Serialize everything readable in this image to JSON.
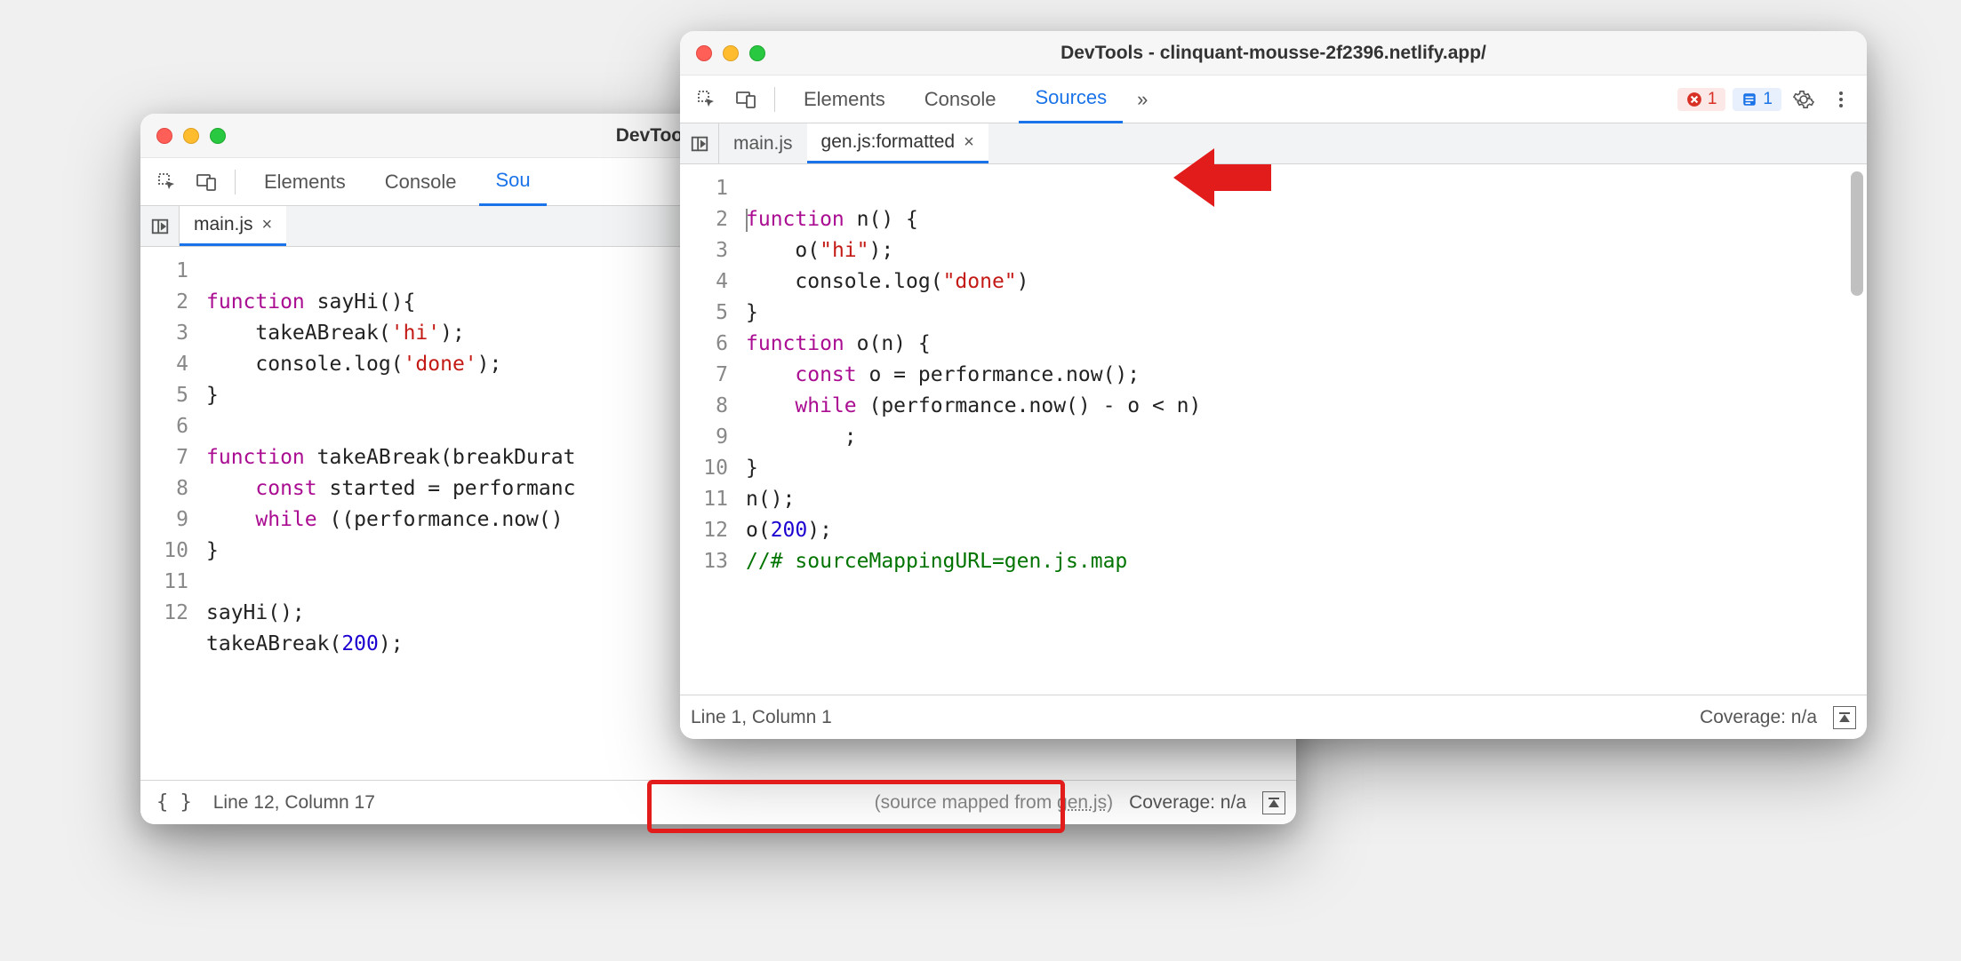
{
  "windows": {
    "back": {
      "title": "DevTools - clinquant-m",
      "tabs": {
        "elements": "Elements",
        "console": "Console",
        "sources": "Sou"
      },
      "file_tabs": [
        {
          "label": "main.js",
          "active": true
        }
      ],
      "code": {
        "lines": [
          "function sayHi(){",
          "    takeABreak('hi');",
          "    console.log('done');",
          "}",
          "",
          "function takeABreak(breakDurat",
          "    const started = performanc",
          "    while ((performance.now() ",
          "}",
          "",
          "sayHi();",
          "takeABreak(200);"
        ]
      },
      "status": {
        "cursor": "Line 12, Column 17",
        "source_mapped": "(source mapped from ",
        "source_mapped_link": "gen.js",
        "source_mapped_end": ")",
        "coverage": "Coverage: n/a"
      }
    },
    "front": {
      "title": "DevTools - clinquant-mousse-2f2396.netlify.app/",
      "tabs": {
        "elements": "Elements",
        "console": "Console",
        "sources": "Sources",
        "more": "»"
      },
      "badges": {
        "errors": "1",
        "info": "1"
      },
      "file_tabs": [
        {
          "label": "main.js",
          "active": false
        },
        {
          "label": "gen.js:formatted",
          "active": true
        }
      ],
      "code": {
        "lines": [
          "function n() {",
          "    o(\"hi\");",
          "    console.log(\"done\")",
          "}",
          "function o(n) {",
          "    const o = performance.now();",
          "    while (performance.now() - o < n)",
          "        ;",
          "}",
          "n();",
          "o(200);",
          "//# sourceMappingURL=gen.js.map",
          ""
        ]
      },
      "status": {
        "cursor": "Line 1, Column 1",
        "coverage": "Coverage: n/a"
      }
    }
  }
}
